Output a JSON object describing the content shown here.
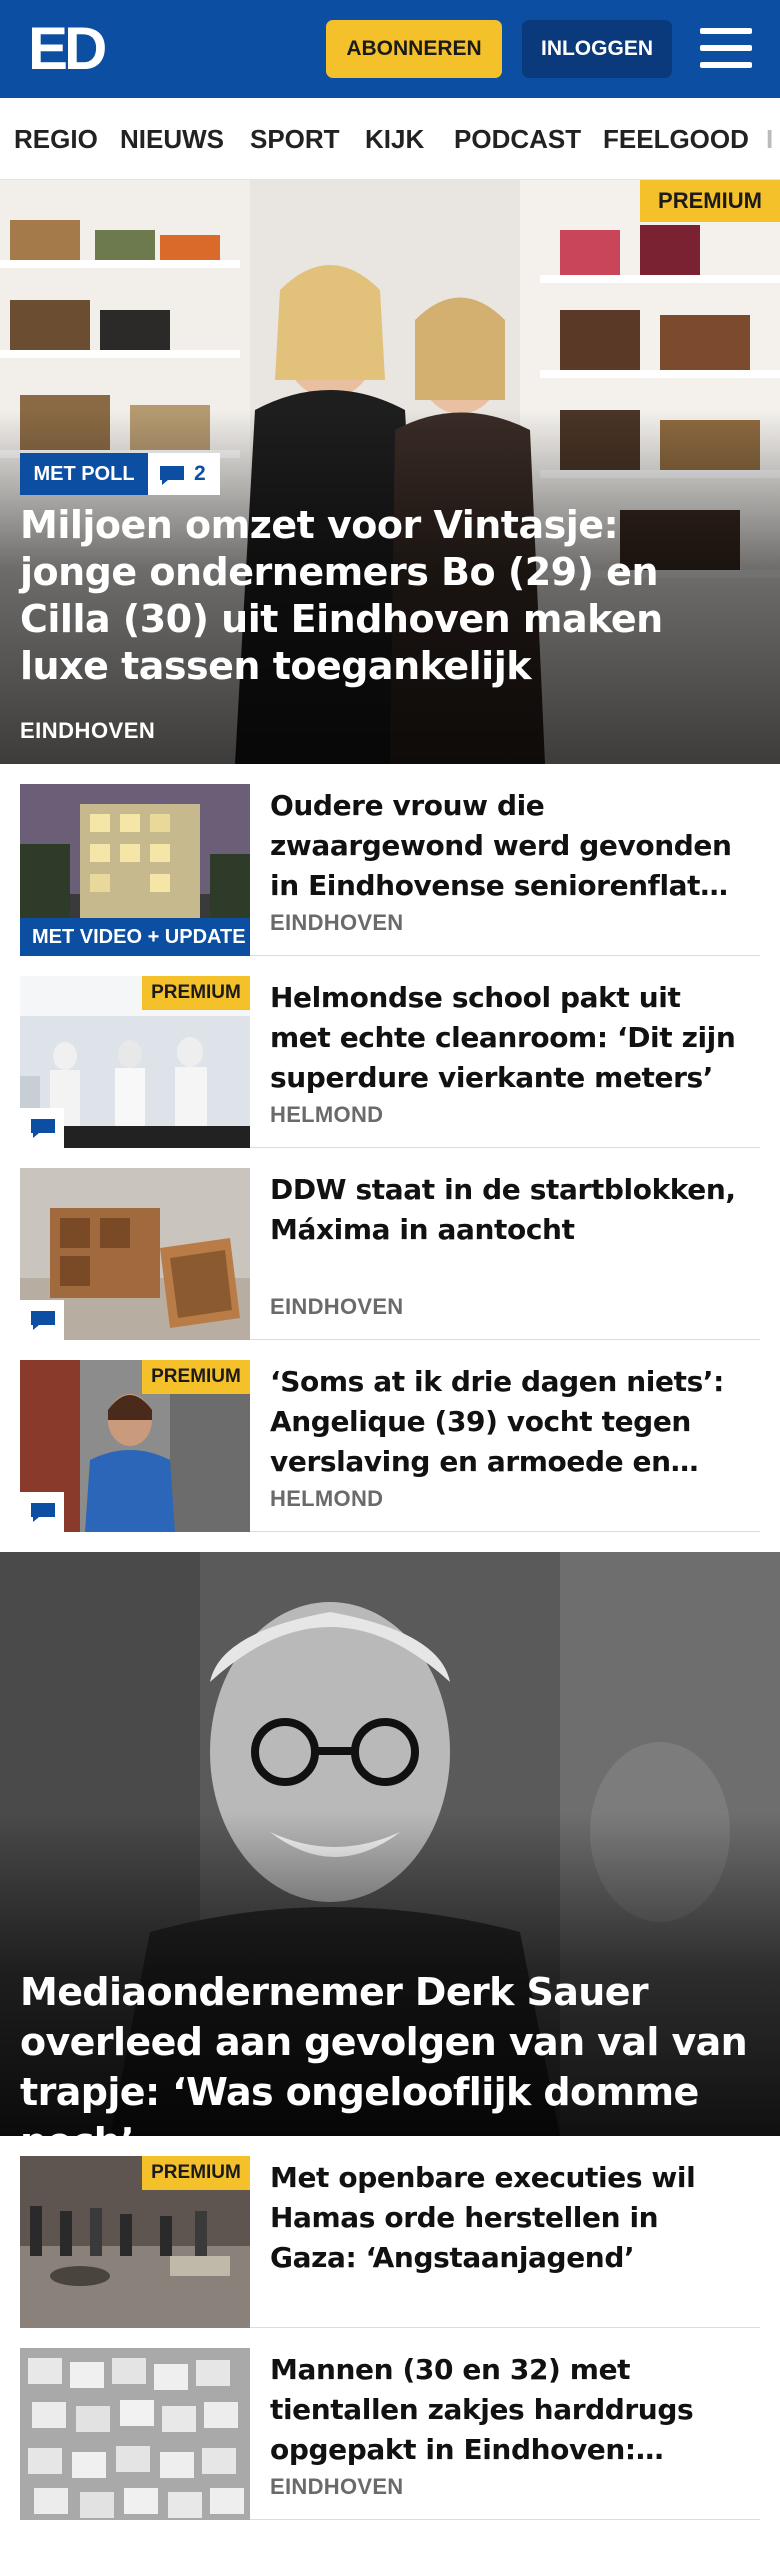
{
  "header": {
    "logo": "ED",
    "subscribe_label": "ABONNEREN",
    "login_label": "INLOGGEN"
  },
  "nav": {
    "items": [
      {
        "label": "REGIO"
      },
      {
        "label": "NIEUWS"
      },
      {
        "label": "SPORT"
      },
      {
        "label": "KIJK"
      },
      {
        "label": "PODCAST"
      },
      {
        "label": "FEELGOOD"
      },
      {
        "label": "I"
      }
    ]
  },
  "hero": {
    "premium_label": "PREMIUM",
    "badge_label": "MET POLL",
    "comment_count": "2",
    "title": "Miljoen omzet voor Vintasje: jonge ondernemers Bo (29) en Cilla (30) uit Eindhoven maken luxe tassen toegankelijk",
    "location": "EINDHOVEN"
  },
  "articles": [
    {
      "title": "Oudere vrouw die zwaargewond werd gevonden in Eindhovense seniorenflat werd waarschijnlijk mishandeld",
      "location": "EINDHOVEN",
      "badge": "MET VIDEO + UPDATE",
      "premium": ""
    },
    {
      "title": "Helmondse school pakt uit met echte cleanroom: ‘Dit zijn superdure vierkante meters’",
      "location": "HELMOND",
      "badge": "",
      "premium": "PREMIUM"
    },
    {
      "title": "DDW staat in de startblokken, Máxima in aantocht",
      "location": "EINDHOVEN",
      "badge": "",
      "premium": ""
    },
    {
      "title": "‘Soms at ik drie dagen niets’: Angelique (39) vocht tegen verslaving en armoede en staat nu zelf klaar voor anderen",
      "location": "HELMOND",
      "badge": "",
      "premium": "PREMIUM"
    }
  ],
  "feature": {
    "title": "Mediaondernemer Derk Sauer overleed aan gevolgen van val van trapje: ‘Was ongelooflijk domme pech’"
  },
  "articles2": [
    {
      "title": "Met openbare executies wil Hamas orde herstellen in Gaza: ‘Angstaanjagend’",
      "location": "",
      "premium": "PREMIUM"
    },
    {
      "title": "Mannen (30 en 32) met tientallen zakjes harddrugs opgepakt in Eindhoven: verlopen apk leidt tot arrestatie",
      "location": "EINDHOVEN",
      "premium": ""
    }
  ],
  "colors": {
    "brand_blue": "#0b4ea2",
    "premium_yellow": "#f5c12a",
    "login_dark_blue": "#0a3a7c"
  },
  "icons": {
    "menu": "hamburger-icon",
    "comment": "comment-bubble-icon"
  }
}
